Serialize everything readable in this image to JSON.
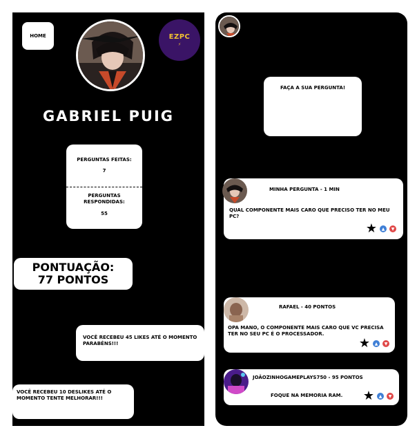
{
  "colors": {
    "background": "#000000",
    "card": "#ffffff",
    "brand_purple": "#3a1466",
    "brand_yellow": "#f2c230",
    "like_blue": "#3f7fd6",
    "dislike_red": "#e04848"
  },
  "profile": {
    "home_label": "HOME",
    "brand_logo_text": "EZPC",
    "brand_logo_sub": "⚡",
    "name": "GABRIEL PUIG",
    "questions_made_label": "PERGUNTAS FEITAS:",
    "questions_made_value": "7",
    "questions_answered_label": "PERGUNTAS RESPONDIDAS:",
    "questions_answered_value": "55",
    "score_line1": "PONTUAÇÃO:",
    "score_line2": "77 PONTOS",
    "likes_message": "VOCÊ RECEBEU 45 LIKES ATÉ O MOMENTO PARABÉNS!!!",
    "dislikes_message": "VOCÊ RECEBEU 10 DESLIKES ATÉ O MOMENTO TENTE MELHORAR!!!"
  },
  "feed": {
    "ask_label": "FAÇA A SUA PERGUNTA!",
    "posts": [
      {
        "title": "MINHA PERGUNTA - 1 MIN",
        "body": "QUAL COMPONENTE MAIS CARO QUE PRECISO TER NO MEU PC?",
        "icons": [
          "star-icon",
          "like-icon",
          "dislike-icon"
        ]
      },
      {
        "title": "RAFAEL - 40 PONTOS",
        "body": "OPA MANO, O COMPONENTE MAIS CARO QUE VC PRECISA TER NO SEU PC É O PROCESSADOR.",
        "icons": [
          "star-icon",
          "like-icon",
          "dislike-icon"
        ]
      },
      {
        "title": "JOÃOZINHOGAMEPLAYS750 - 95 PONTOS",
        "body": "FOQUE NA MEMORIA RAM.",
        "icons": [
          "star-icon",
          "like-icon",
          "dislike-icon"
        ]
      }
    ]
  }
}
